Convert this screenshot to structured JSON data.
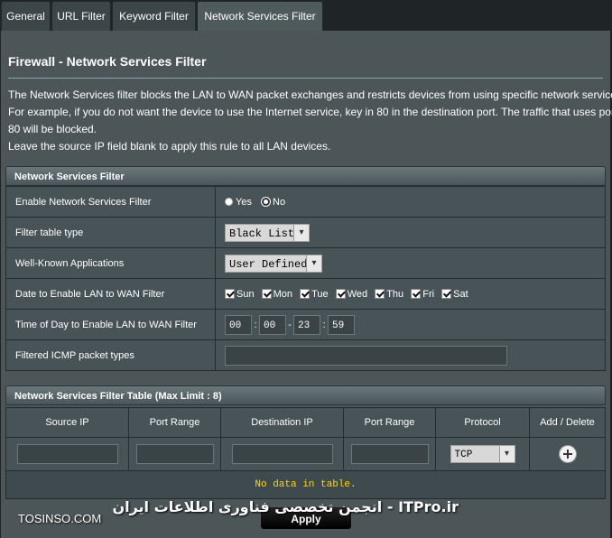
{
  "tabs": [
    {
      "label": "General"
    },
    {
      "label": "URL Filter"
    },
    {
      "label": "Keyword Filter"
    },
    {
      "label": "Network Services Filter"
    }
  ],
  "page": {
    "title": "Firewall - Network Services Filter",
    "desc1": "The Network Services filter blocks the LAN to WAN packet exchanges and restricts devices from using specific network services.",
    "desc2": "For example, if you do not want the device to use the Internet service, key in 80 in the destination port. The traffic that uses port",
    "desc3": "80 will be blocked.",
    "desc4": "Leave the source IP field blank to apply this rule to all LAN devices."
  },
  "settings": {
    "header": "Network Services Filter",
    "enable_label": "Enable Network Services Filter",
    "yes_label": "Yes",
    "no_label": "No",
    "filter_type_label": "Filter table type",
    "filter_type_value": "Black List",
    "wellknown_label": "Well-Known Applications",
    "wellknown_value": "User Defined",
    "date_label": "Date to Enable LAN to WAN Filter",
    "days": [
      "Sun",
      "Mon",
      "Tue",
      "Wed",
      "Thu",
      "Fri",
      "Sat"
    ],
    "time_label": "Time of Day to Enable LAN to WAN Filter",
    "time_start_h": "00",
    "time_start_m": "00",
    "time_end_h": "23",
    "time_end_m": "59",
    "time_colon": ":",
    "time_dash": "-",
    "icmp_label": "Filtered ICMP packet types"
  },
  "table": {
    "header": "Network Services Filter Table (Max Limit : 8)",
    "columns": [
      "Source IP",
      "Port Range",
      "Destination IP",
      "Port Range",
      "Protocol",
      "Add / Delete"
    ],
    "protocol_value": "TCP",
    "empty_text": "No data in table."
  },
  "apply_label": "Apply",
  "watermark": {
    "left": "TOSINSO.COM",
    "right": "ITPro.ir - انجمن تخصصی فناوری اطلاعات ایران"
  }
}
